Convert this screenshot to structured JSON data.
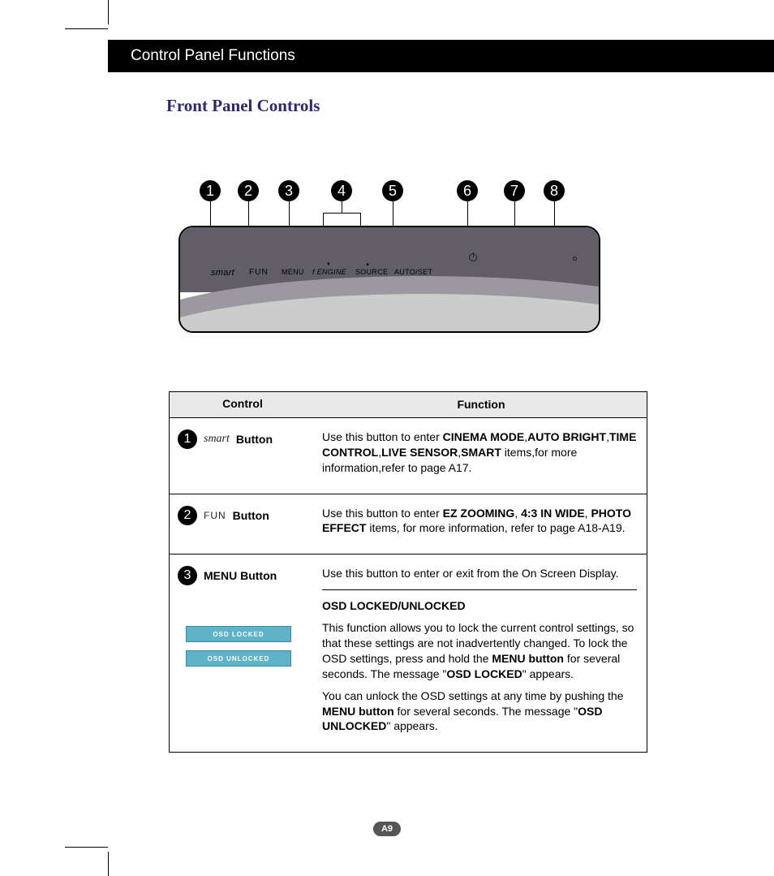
{
  "header": {
    "title": "Control Panel Functions"
  },
  "section_title": "Front Panel Controls",
  "panel": {
    "badges": [
      "1",
      "2",
      "3",
      "4",
      "5",
      "6",
      "7",
      "8"
    ],
    "labels": {
      "smart": "smart",
      "fun": "FUN",
      "menu": "MENU",
      "engine": "ENGINE",
      "source": "SOURCE",
      "autoset": "AUTO/SET"
    }
  },
  "table": {
    "head": {
      "control": "Control",
      "function": "Function"
    },
    "rows": [
      {
        "badge": "1",
        "control_label": "Button",
        "control_prefix_type": "smart",
        "func_html": "Use this button to enter <b>CINEMA MODE</b>,<b>AUTO BRIGHT</b>,<b>TIME CONTROL</b>,<b>LIVE SENSOR</b>,<b>SMART</b> items,for more information,refer to page A17."
      },
      {
        "badge": "2",
        "control_label": "Button",
        "control_prefix_type": "fun",
        "func_html": "Use this button to enter <b>EZ ZOOMING</b>, <b>4:3 IN WIDE</b>, <b>PHOTO EFFECT</b> items, for more information, refer to page A18-A19."
      },
      {
        "badge": "3",
        "control_label": "MENU Button",
        "func_line1": "Use this button to enter or exit from the On Screen Display.",
        "osd_title": "OSD LOCKED/UNLOCKED",
        "osd_p1": "This function allows you to lock the current control settings, so that these settings are not inadvertently changed. To lock the OSD settings, press and hold the <b>MENU button</b> for several seconds. The message \"<b>OSD LOCKED</b>\" appears.",
        "osd_p2": "You can unlock the OSD settings at any time by pushing the <b>MENU button</b> for several seconds. The message \"<b>OSD UNLOCKED</b>\" appears.",
        "osd_locked_label": "OSD LOCKED",
        "osd_unlocked_label": "OSD UNLOCKED"
      }
    ]
  },
  "page_number": "A9"
}
